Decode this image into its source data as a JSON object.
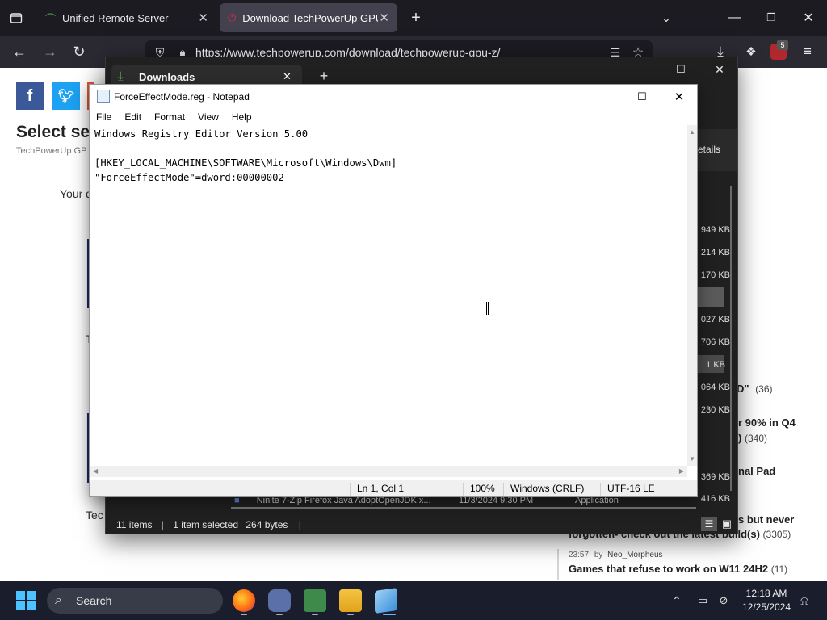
{
  "browser": {
    "tabs": [
      {
        "label": "Unified Remote Server"
      },
      {
        "label": "Download TechPowerUp GPU-Z"
      }
    ],
    "url": "https://www.techpowerup.com/download/techpowerup-gpu-z/",
    "extension_badge": "5"
  },
  "webpage": {
    "heading": "Select ser",
    "subheading": "TechPowerUp GP",
    "your_text": "Your d",
    "t_text": "T",
    "tec_text": "Tec",
    "details_text": "etails",
    "forum": [
      {
        "text": "D\"",
        "count": "(36)"
      },
      {
        "text": "r 90% in Q4",
        "count": ""
      },
      {
        "text": ")",
        "count": "(340)"
      },
      {
        "text": "nal Pad",
        "count": ""
      },
      {
        "text": "s but never",
        "count": ""
      },
      {
        "text": "forgotten- check out the latest build(s)",
        "count": "(3305)"
      },
      {
        "time": "23:57",
        "by": "by",
        "user": "Neo_Morpheus"
      },
      {
        "text": "Games that refuse to work on W11 24H2",
        "count": "(11)"
      }
    ]
  },
  "downloads": {
    "tab_label": "Downloads",
    "sizes": [
      "949 KB",
      "214 KB",
      "170 KB",
      "027 KB",
      "706 KB",
      "1 KB",
      "064 KB",
      "230 KB",
      "369 KB",
      "416 KB"
    ],
    "peek_row": {
      "name": "Ninite 7-Zip Firefox Java AdoptOpenJDK x...",
      "date": "11/3/2024 9:30 PM",
      "type": "Application"
    },
    "status": {
      "items": "11 items",
      "selected": "1 item selected",
      "bytes": "264 bytes"
    }
  },
  "notepad": {
    "title": "ForceEffectMode.reg - Notepad",
    "menu": [
      "File",
      "Edit",
      "Format",
      "View",
      "Help"
    ],
    "lines": [
      "Windows Registry Editor Version 5.00",
      "",
      "[HKEY_LOCAL_MACHINE\\SOFTWARE\\Microsoft\\Windows\\Dwm]",
      "\"ForceEffectMode\"=dword:00000002"
    ],
    "status": {
      "position": "Ln 1, Col 1",
      "zoom": "100%",
      "eol": "Windows (CRLF)",
      "encoding": "UTF-16 LE"
    }
  },
  "taskbar": {
    "search": "Search",
    "time": "12:18 AM",
    "date": "12/25/2024"
  }
}
